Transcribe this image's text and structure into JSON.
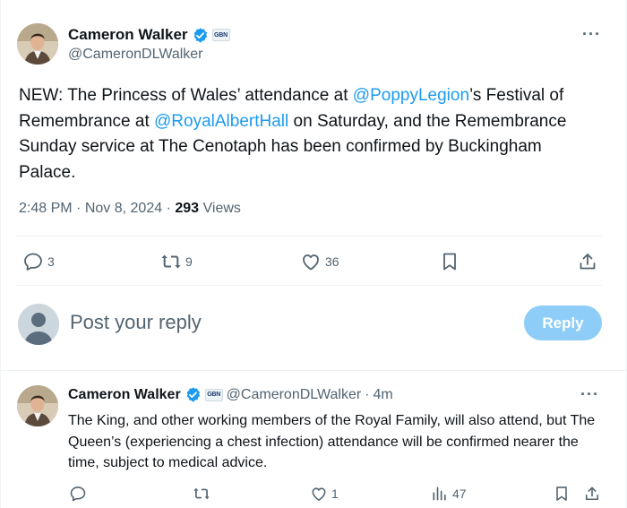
{
  "main_tweet": {
    "author_name": "Cameron Walker",
    "handle": "@CameronDLWalker",
    "affiliation_badge": "GBN",
    "text_parts": [
      "NEW: The Princess of Wales’ attendance at ",
      "@PoppyLegion",
      "’s Festival of Remembrance at ",
      "@RoyalAlbertHall",
      " on Saturday, and the Remembrance Sunday service at The Cenotaph has been confirmed by Buckingham Palace."
    ],
    "time": "2:48 PM",
    "date": "Nov 8, 2024",
    "views_count": "293",
    "views_label": "Views",
    "replies": "3",
    "reposts": "9",
    "likes": "36"
  },
  "composer": {
    "placeholder": "Post your reply",
    "button_label": "Reply"
  },
  "reply_tweet": {
    "author_name": "Cameron Walker",
    "handle": "@CameronDLWalker",
    "affiliation_badge": "GBN",
    "age": "4m",
    "text": "The King, and other working members of the Royal Family, will also attend, but The Queen’s (experiencing a chest infection) attendance will be confirmed nearer the time, subject to medical advice.",
    "likes": "1",
    "views": "47"
  },
  "colors": {
    "accent": "#1d9bf0",
    "secondary_text": "#536471",
    "reply_button": "#8ecdf7"
  }
}
